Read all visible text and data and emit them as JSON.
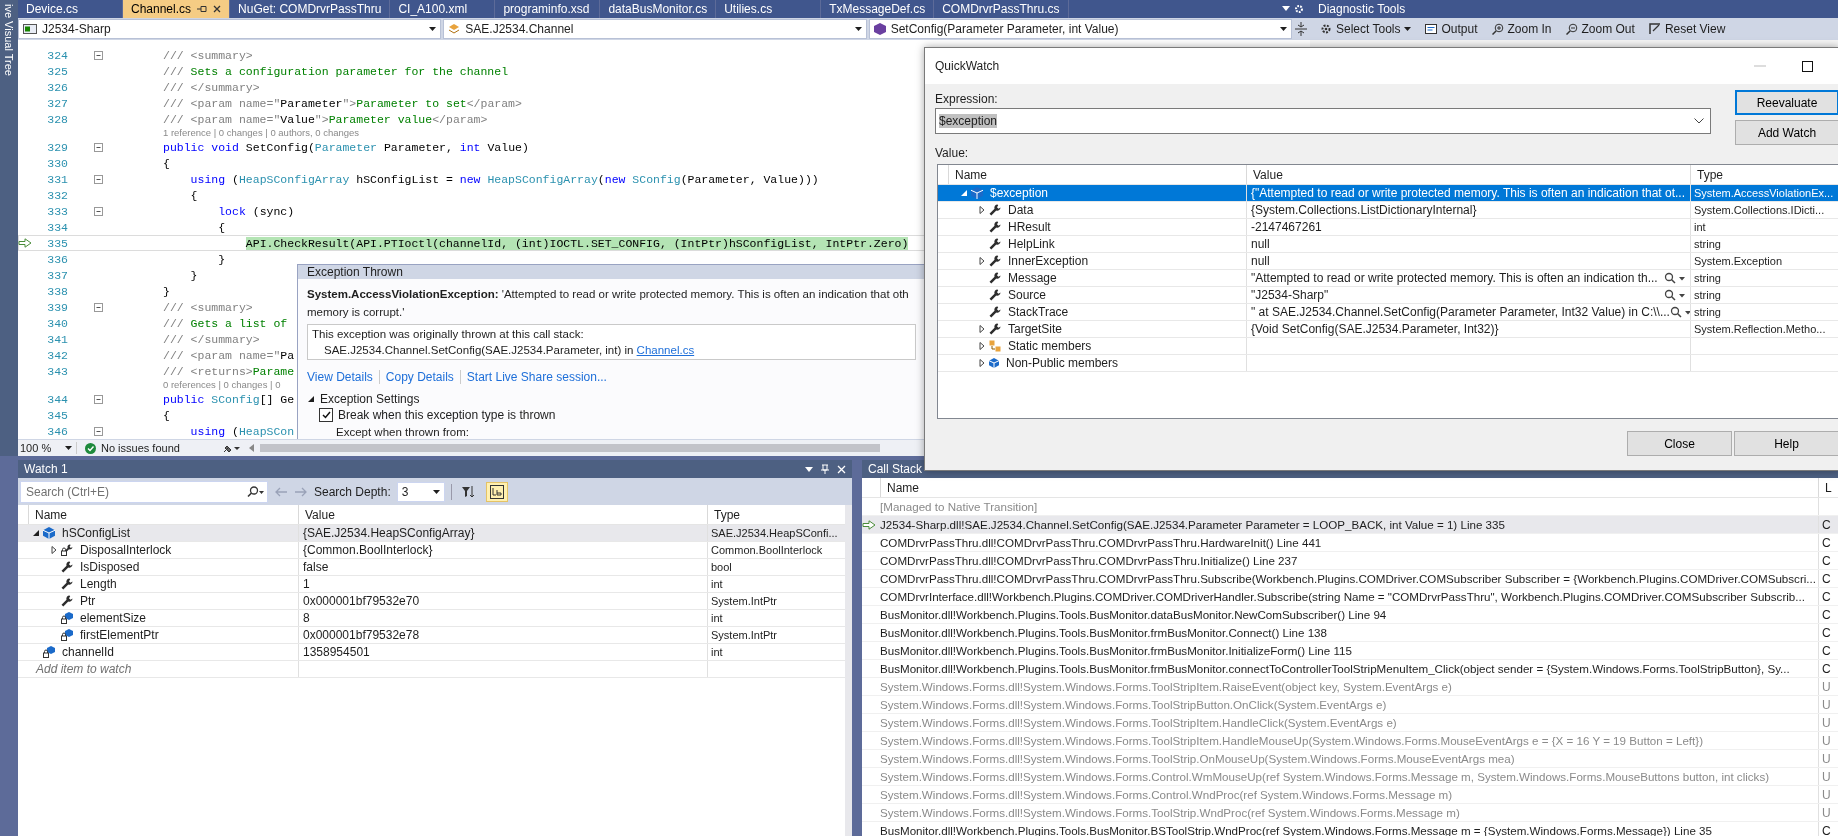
{
  "side_strip": {
    "label": "ive Visual Tree"
  },
  "document_tabs": [
    {
      "label": "Device.cs",
      "selected": false
    },
    {
      "label": "Channel.cs",
      "selected": true
    },
    {
      "label": "NuGet: COMDrvrPassThru",
      "selected": false
    },
    {
      "label": "CI_A100.xml",
      "selected": false
    },
    {
      "label": "programinfo.xsd",
      "selected": false
    },
    {
      "label": "dataBusMonitor.cs",
      "selected": false
    },
    {
      "label": "Utilies.cs",
      "selected": false
    },
    {
      "label": "TxMessageDef.cs",
      "selected": false
    },
    {
      "label": "COMDrvrPassThru.cs",
      "selected": false
    }
  ],
  "navigation_bar": {
    "project": "J2534-Sharp",
    "type": "SAE.J2534.Channel",
    "member": "SetConfig(Parameter Parameter, int Value)"
  },
  "code_editor": {
    "lines": [
      {
        "kind": "code",
        "number": "324",
        "fold": true,
        "current": false,
        "tokens": [
          {
            "kind": "doc",
            "text": "/// <summary>"
          }
        ]
      },
      {
        "kind": "code",
        "number": "325",
        "fold": false,
        "current": false,
        "tokens": [
          {
            "kind": "doc",
            "text": "/// "
          },
          {
            "kind": "comment",
            "text": "Sets a configuration parameter for the channel"
          }
        ]
      },
      {
        "kind": "code",
        "number": "326",
        "fold": false,
        "current": false,
        "tokens": [
          {
            "kind": "doc",
            "text": "/// </summary>"
          }
        ]
      },
      {
        "kind": "code",
        "number": "327",
        "fold": false,
        "current": false,
        "tokens": [
          {
            "kind": "doc",
            "text": "/// <param name=\""
          },
          {
            "kind": "plain",
            "text": "Parameter"
          },
          {
            "kind": "doc",
            "text": "\">"
          },
          {
            "kind": "comment",
            "text": "Parameter to set"
          },
          {
            "kind": "doc",
            "text": "</param>"
          }
        ]
      },
      {
        "kind": "code",
        "number": "328",
        "fold": false,
        "current": false,
        "tokens": [
          {
            "kind": "doc",
            "text": "/// <param name=\""
          },
          {
            "kind": "plain",
            "text": "Value"
          },
          {
            "kind": "doc",
            "text": "\">"
          },
          {
            "kind": "comment",
            "text": "Parameter value"
          },
          {
            "kind": "doc",
            "text": "</param>"
          }
        ]
      },
      {
        "kind": "lens",
        "text": "1 reference | 0 changes | 0 authors, 0 changes"
      },
      {
        "kind": "code",
        "number": "329",
        "fold": true,
        "current": false,
        "tokens": [
          {
            "kind": "keyword",
            "text": "public void "
          },
          {
            "kind": "plain",
            "text": "SetConfig("
          },
          {
            "kind": "type",
            "text": "Parameter"
          },
          {
            "kind": "plain",
            "text": " Parameter, "
          },
          {
            "kind": "keyword",
            "text": "int"
          },
          {
            "kind": "plain",
            "text": " Value)"
          }
        ]
      },
      {
        "kind": "code",
        "number": "330",
        "fold": false,
        "current": false,
        "tokens": [
          {
            "kind": "plain",
            "text": "{"
          }
        ]
      },
      {
        "kind": "code",
        "number": "331",
        "fold": true,
        "current": false,
        "tokens": [
          {
            "kind": "keyword",
            "text": "    using"
          },
          {
            "kind": "plain",
            "text": " ("
          },
          {
            "kind": "type",
            "text": "HeapSConfigArray"
          },
          {
            "kind": "plain",
            "text": " hSConfigList = "
          },
          {
            "kind": "keyword",
            "text": "new "
          },
          {
            "kind": "type",
            "text": "HeapSConfigArray"
          },
          {
            "kind": "plain",
            "text": "("
          },
          {
            "kind": "keyword",
            "text": "new "
          },
          {
            "kind": "type",
            "text": "SConfig"
          },
          {
            "kind": "plain",
            "text": "(Parameter, Value)))"
          }
        ]
      },
      {
        "kind": "code",
        "number": "332",
        "fold": false,
        "current": false,
        "tokens": [
          {
            "kind": "plain",
            "text": "    {"
          }
        ]
      },
      {
        "kind": "code",
        "number": "333",
        "fold": true,
        "current": false,
        "tokens": [
          {
            "kind": "keyword",
            "text": "        lock"
          },
          {
            "kind": "plain",
            "text": " (sync)"
          }
        ]
      },
      {
        "kind": "code",
        "number": "334",
        "fold": false,
        "current": false,
        "tokens": [
          {
            "kind": "plain",
            "text": "        {"
          }
        ]
      },
      {
        "kind": "code",
        "number": "335",
        "fold": false,
        "current": true,
        "tokens": [
          {
            "kind": "active",
            "text": "            API.CheckResult(API.PTIoctl(channelId, (int)IOCTL.SET_CONFIG, (IntPtr)hSConfigList, IntPtr.Zero)"
          }
        ]
      },
      {
        "kind": "code",
        "number": "336",
        "fold": false,
        "current": false,
        "tokens": [
          {
            "kind": "plain",
            "text": "        }"
          }
        ]
      },
      {
        "kind": "code",
        "number": "337",
        "fold": false,
        "current": false,
        "tokens": [
          {
            "kind": "plain",
            "text": "    }"
          }
        ]
      },
      {
        "kind": "code",
        "number": "338",
        "fold": false,
        "current": false,
        "tokens": [
          {
            "kind": "plain",
            "text": "}"
          }
        ]
      },
      {
        "kind": "code",
        "number": "339",
        "fold": true,
        "current": false,
        "tokens": [
          {
            "kind": "doc",
            "text": "/// <summary>"
          }
        ]
      },
      {
        "kind": "code",
        "number": "340",
        "fold": false,
        "current": false,
        "tokens": [
          {
            "kind": "doc",
            "text": "/// "
          },
          {
            "kind": "comment",
            "text": "Gets a list of"
          }
        ]
      },
      {
        "kind": "code",
        "number": "341",
        "fold": false,
        "current": false,
        "tokens": [
          {
            "kind": "doc",
            "text": "/// </summary>"
          }
        ]
      },
      {
        "kind": "code",
        "number": "342",
        "fold": false,
        "current": false,
        "tokens": [
          {
            "kind": "doc",
            "text": "/// <param name=\""
          },
          {
            "kind": "plain",
            "text": "Pa"
          }
        ]
      },
      {
        "kind": "code",
        "number": "343",
        "fold": false,
        "current": false,
        "tokens": [
          {
            "kind": "doc",
            "text": "/// <returns>"
          },
          {
            "kind": "comment",
            "text": "Parame"
          }
        ]
      },
      {
        "kind": "lens",
        "text": "0 references | 0 changes | 0"
      },
      {
        "kind": "code",
        "number": "344",
        "fold": true,
        "current": false,
        "tokens": [
          {
            "kind": "keyword",
            "text": "public "
          },
          {
            "kind": "type",
            "text": "SConfig"
          },
          {
            "kind": "plain",
            "text": "[] Ge"
          }
        ]
      },
      {
        "kind": "code",
        "number": "345",
        "fold": false,
        "current": false,
        "tokens": [
          {
            "kind": "plain",
            "text": "{"
          }
        ]
      },
      {
        "kind": "code",
        "number": "346",
        "fold": true,
        "current": false,
        "tokens": [
          {
            "kind": "keyword",
            "text": "    using"
          },
          {
            "kind": "plain",
            "text": " ("
          },
          {
            "kind": "type",
            "text": "HeapSCon"
          }
        ]
      }
    ],
    "status": {
      "zoom": "100 %",
      "issues": "No issues found"
    }
  },
  "exception_popup": {
    "title": "Exception Thrown",
    "message_lines": [
      "**System.AccessViolationException:** 'Attempted to read or write protected memory. This is often an indication that oth",
      "memory is corrupt.'"
    ],
    "stack_heading": "This exception was originally thrown at this call stack:",
    "stack_frame": "SAE.J2534.Channel.SetConfig(SAE.J2534.Parameter, int) in ",
    "stack_link": "Channel.cs",
    "links": [
      "View Details",
      "Copy Details",
      "Start Live Share session..."
    ],
    "settings": {
      "title": "Exception Settings",
      "expanded": true,
      "options": [
        {
          "label": "Break when this exception type is thrown",
          "checked": true
        }
      ],
      "except_label": "Except when thrown from:"
    }
  },
  "diagnostic_tools": {
    "title": "Diagnostic Tools",
    "tools": [
      {
        "label": "Select Tools",
        "kind": "select"
      },
      {
        "label": "Output",
        "kind": "output"
      },
      {
        "label": "Zoom In",
        "kind": "zoom-in"
      },
      {
        "label": "Zoom Out",
        "kind": "zoom-out"
      },
      {
        "label": "Reset View",
        "kind": "reset"
      }
    ]
  },
  "quickwatch": {
    "title": "QuickWatch",
    "expression_label": "Expression:",
    "expression": "$exception",
    "buttons": [
      "Reevaluate",
      "Add Watch"
    ],
    "value_label": "Value:",
    "columns": [
      "Name",
      "Value",
      "Type"
    ],
    "rows": [
      {
        "name": "$exception",
        "value": "{\"Attempted to read or write protected memory. This is often an indication that ot...",
        "type": "System.AccessViolationEx...",
        "kind": "object",
        "expanded": true,
        "selected": true,
        "visualizer": false,
        "children": [
          {
            "name": "Data",
            "value": "{System.Collections.ListDictionaryInternal}",
            "type": "System.Collections.IDicti...",
            "kind": "property",
            "expanded": false,
            "selected": false,
            "visualizer": false
          },
          {
            "name": "HResult",
            "value": "-2147467261",
            "type": "int",
            "kind": "property",
            "selected": false,
            "visualizer": false
          },
          {
            "name": "HelpLink",
            "value": "null",
            "type": "string",
            "kind": "property",
            "selected": false,
            "visualizer": false
          },
          {
            "name": "InnerException",
            "value": "null",
            "type": "System.Exception",
            "kind": "property",
            "expanded": false,
            "selected": false,
            "visualizer": false
          },
          {
            "name": "Message",
            "value": "\"Attempted to read or write protected memory. This is often an indication th...",
            "type": "string",
            "kind": "property",
            "selected": false,
            "visualizer": true
          },
          {
            "name": "Source",
            "value": "\"J2534-Sharp\"",
            "type": "string",
            "kind": "property",
            "selected": false,
            "visualizer": true
          },
          {
            "name": "StackTrace",
            "value": "\"   at SAE.J2534.Channel.SetConfig(Parameter Parameter, Int32 Value) in C:\\\\...",
            "type": "string",
            "kind": "property",
            "selected": false,
            "visualizer": true
          },
          {
            "name": "TargetSite",
            "value": "{Void SetConfig(SAE.J2534.Parameter, Int32)}",
            "type": "System.Reflection.Metho...",
            "kind": "property",
            "expanded": false,
            "selected": false,
            "visualizer": false
          },
          {
            "name": "Static members",
            "kind": "static",
            "expanded": false,
            "selected": false,
            "visualizer": false
          },
          {
            "name": "Non-Public members",
            "kind": "nonpublic",
            "expanded": false,
            "selected": false,
            "visualizer": false
          }
        ]
      }
    ],
    "footer_buttons": [
      "Close",
      "Help"
    ]
  },
  "watch": {
    "title": "Watch 1",
    "search_placeholder": "Search (Ctrl+E)",
    "search_depth_label": "Search Depth:",
    "search_depth": "3",
    "tool_buttons": [
      {
        "kind": "filter",
        "pressed": false
      },
      {
        "kind": "string",
        "pressed": true
      }
    ],
    "columns": [
      "Name",
      "Value",
      "Type"
    ],
    "rows": [
      {
        "name": "hSConfigList",
        "value": "{SAE.J2534.HeapSConfigArray}",
        "type": "SAE.J2534.HeapSConfi...",
        "kind": "object",
        "expanded": true,
        "selected": true,
        "children": [
          {
            "name": "DisposalInterlock",
            "value": "{Common.BoolInterlock}",
            "type": "Common.BoolInterlock",
            "kind": "private-property",
            "expanded": false,
            "selected": false
          },
          {
            "name": "IsDisposed",
            "value": "false",
            "type": "bool",
            "kind": "property",
            "selected": false
          },
          {
            "name": "Length",
            "value": "1",
            "type": "int",
            "kind": "property",
            "selected": false
          },
          {
            "name": "Ptr",
            "value": "0x000001bf79532e70",
            "type": "System.IntPtr",
            "kind": "property",
            "selected": false
          },
          {
            "name": "elementSize",
            "value": "8",
            "type": "int",
            "kind": "private-field",
            "selected": false
          },
          {
            "name": "firstElementPtr",
            "value": "0x000001bf79532e78",
            "type": "System.IntPtr",
            "kind": "private-field",
            "selected": false
          }
        ]
      },
      {
        "name": "channelId",
        "value": "1358954501",
        "type": "int",
        "kind": "private-field",
        "selected": false
      }
    ],
    "add_placeholder": "Add item to watch"
  },
  "call_stack": {
    "title": "Call Stack",
    "columns": [
      "Name",
      "L"
    ],
    "rows": [
      {
        "text": "[Managed to Native Transition]",
        "external": true,
        "current": false
      },
      {
        "text": "J2534-Sharp.dll!SAE.J2534.Channel.SetConfig(SAE.J2534.Parameter Parameter = LOOP_BACK, int Value = 1) Line 335",
        "language": "C",
        "external": false,
        "current": true
      },
      {
        "text": "COMDrvrPassThru.dll!COMDrvrPassThru.COMDrvrPassThru.HardwareInit() Line 441",
        "language": "C",
        "external": false,
        "current": false
      },
      {
        "text": "COMDrvrPassThru.dll!COMDrvrPassThru.COMDrvrPassThru.Initialize() Line 237",
        "language": "C",
        "external": false,
        "current": false
      },
      {
        "text": "COMDrvrPassThru.dll!COMDrvrPassThru.COMDrvrPassThru.Subscribe(Workbench.Plugins.COMDriver.COMSubscriber Subscriber = {Workbench.Plugins.COMDriver.COMSubscri...",
        "language": "C",
        "external": false,
        "current": false
      },
      {
        "text": "COMDrvrInterface.dll!Workbench.Plugins.COMDriver.COMDriverHandler.Subscribe(string Name = \"COMDrvrPassThru\", Workbench.Plugins.COMDriver.COMSubscriber Subscrib...",
        "language": "C",
        "external": false,
        "current": false
      },
      {
        "text": "BusMonitor.dll!Workbench.Plugins.Tools.BusMonitor.dataBusMonitor.NewComSubscriber() Line 94",
        "language": "C",
        "external": false,
        "current": false
      },
      {
        "text": "BusMonitor.dll!Workbench.Plugins.Tools.BusMonitor.frmBusMonitor.Connect() Line 138",
        "language": "C",
        "external": false,
        "current": false
      },
      {
        "text": "BusMonitor.dll!Workbench.Plugins.Tools.BusMonitor.frmBusMonitor.InitializeForm() Line 115",
        "language": "C",
        "external": false,
        "current": false
      },
      {
        "text": "BusMonitor.dll!Workbench.Plugins.Tools.BusMonitor.frmBusMonitor.connectToControllerToolStripMenuItem_Click(object sender = {System.Windows.Forms.ToolStripButton}, Sy...",
        "language": "C",
        "external": false,
        "current": false
      },
      {
        "text": "System.Windows.Forms.dll!System.Windows.Forms.ToolStripItem.RaiseEvent(object key, System.EventArgs e)",
        "language": "U",
        "external": true,
        "current": false
      },
      {
        "text": "System.Windows.Forms.dll!System.Windows.Forms.ToolStripButton.OnClick(System.EventArgs e)",
        "language": "U",
        "external": true,
        "current": false
      },
      {
        "text": "System.Windows.Forms.dll!System.Windows.Forms.ToolStripItem.HandleClick(System.EventArgs e)",
        "language": "U",
        "external": true,
        "current": false
      },
      {
        "text": "System.Windows.Forms.dll!System.Windows.Forms.ToolStripItem.HandleMouseUp(System.Windows.Forms.MouseEventArgs e = {X = 16 Y = 19 Button = Left})",
        "language": "U",
        "external": true,
        "current": false
      },
      {
        "text": "System.Windows.Forms.dll!System.Windows.Forms.ToolStrip.OnMouseUp(System.Windows.Forms.MouseEventArgs mea)",
        "language": "U",
        "external": true,
        "current": false
      },
      {
        "text": "System.Windows.Forms.dll!System.Windows.Forms.Control.WmMouseUp(ref System.Windows.Forms.Message m, System.Windows.Forms.MouseButtons button, int clicks)",
        "language": "U",
        "external": true,
        "current": false
      },
      {
        "text": "System.Windows.Forms.dll!System.Windows.Forms.Control.WndProc(ref System.Windows.Forms.Message m)",
        "language": "U",
        "external": true,
        "current": false
      },
      {
        "text": "System.Windows.Forms.dll!System.Windows.Forms.ToolStrip.WndProc(ref System.Windows.Forms.Message m)",
        "language": "U",
        "external": true,
        "current": false
      },
      {
        "text": "BusMonitor.dll!Workbench.Plugins.Tools.BusMonitor.BSToolStrip.WndProc(ref System.Windows.Forms.Message m = {System.Windows.Forms.Message}) Line 35",
        "language": "C",
        "external": false,
        "current": false
      }
    ]
  }
}
